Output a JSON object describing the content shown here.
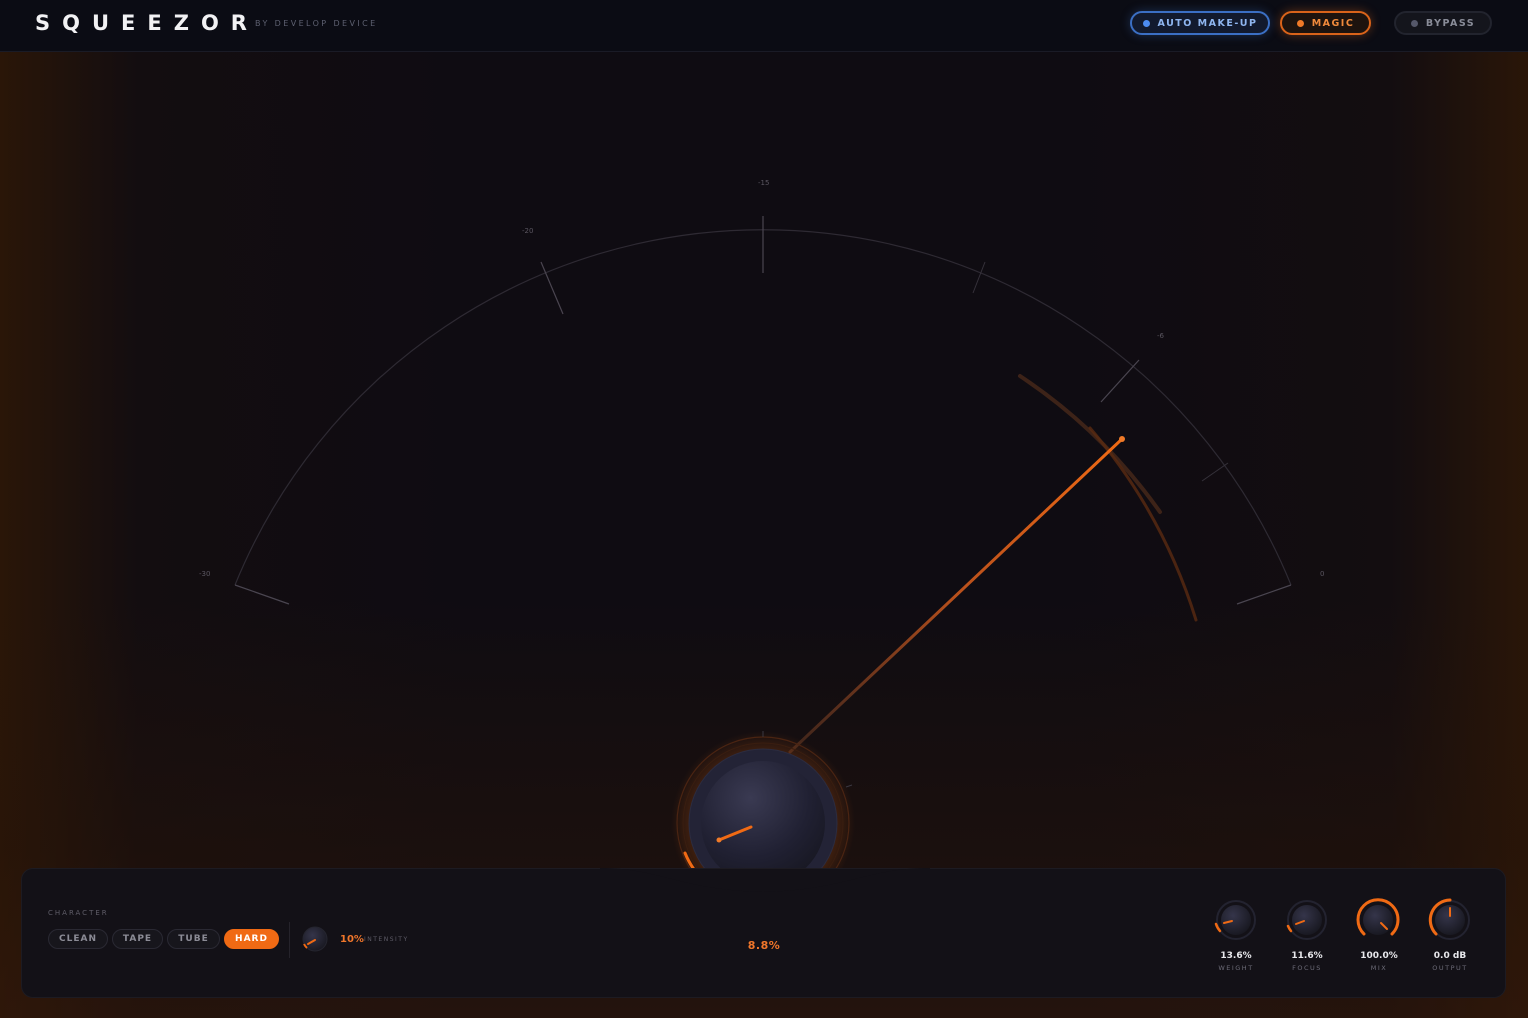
{
  "header": {
    "logo": "SQUEEZOR",
    "byline": "BY DEVELOP DEVICE",
    "buttons": {
      "auto_makeup": "AUTO MAKE-UP",
      "magic": "MAGIC",
      "bypass": "BYPASS"
    }
  },
  "meter": {
    "scale_labels": {
      "m30": "-30",
      "m20": "-20",
      "m15": "-15",
      "m6": "-6",
      "zero": "0"
    },
    "needle_position": 0.85,
    "main_knob_value": "8.8%"
  },
  "character": {
    "label": "CHARACTER",
    "modes": [
      "CLEAN",
      "TAPE",
      "TUBE",
      "HARD"
    ],
    "selected": "HARD",
    "intensity_value": "10%",
    "intensity_label": "INTENSITY"
  },
  "knobs": [
    {
      "value": "13.6%",
      "label": "WEIGHT"
    },
    {
      "value": "11.6%",
      "label": "FOCUS"
    },
    {
      "value": "100.0%",
      "label": "MIX"
    },
    {
      "value": "0.0 dB",
      "label": "OUTPUT"
    }
  ],
  "colors": {
    "accent_orange": "#f06a14",
    "accent_blue": "#3b6fc4",
    "background": "#0d0b10"
  }
}
